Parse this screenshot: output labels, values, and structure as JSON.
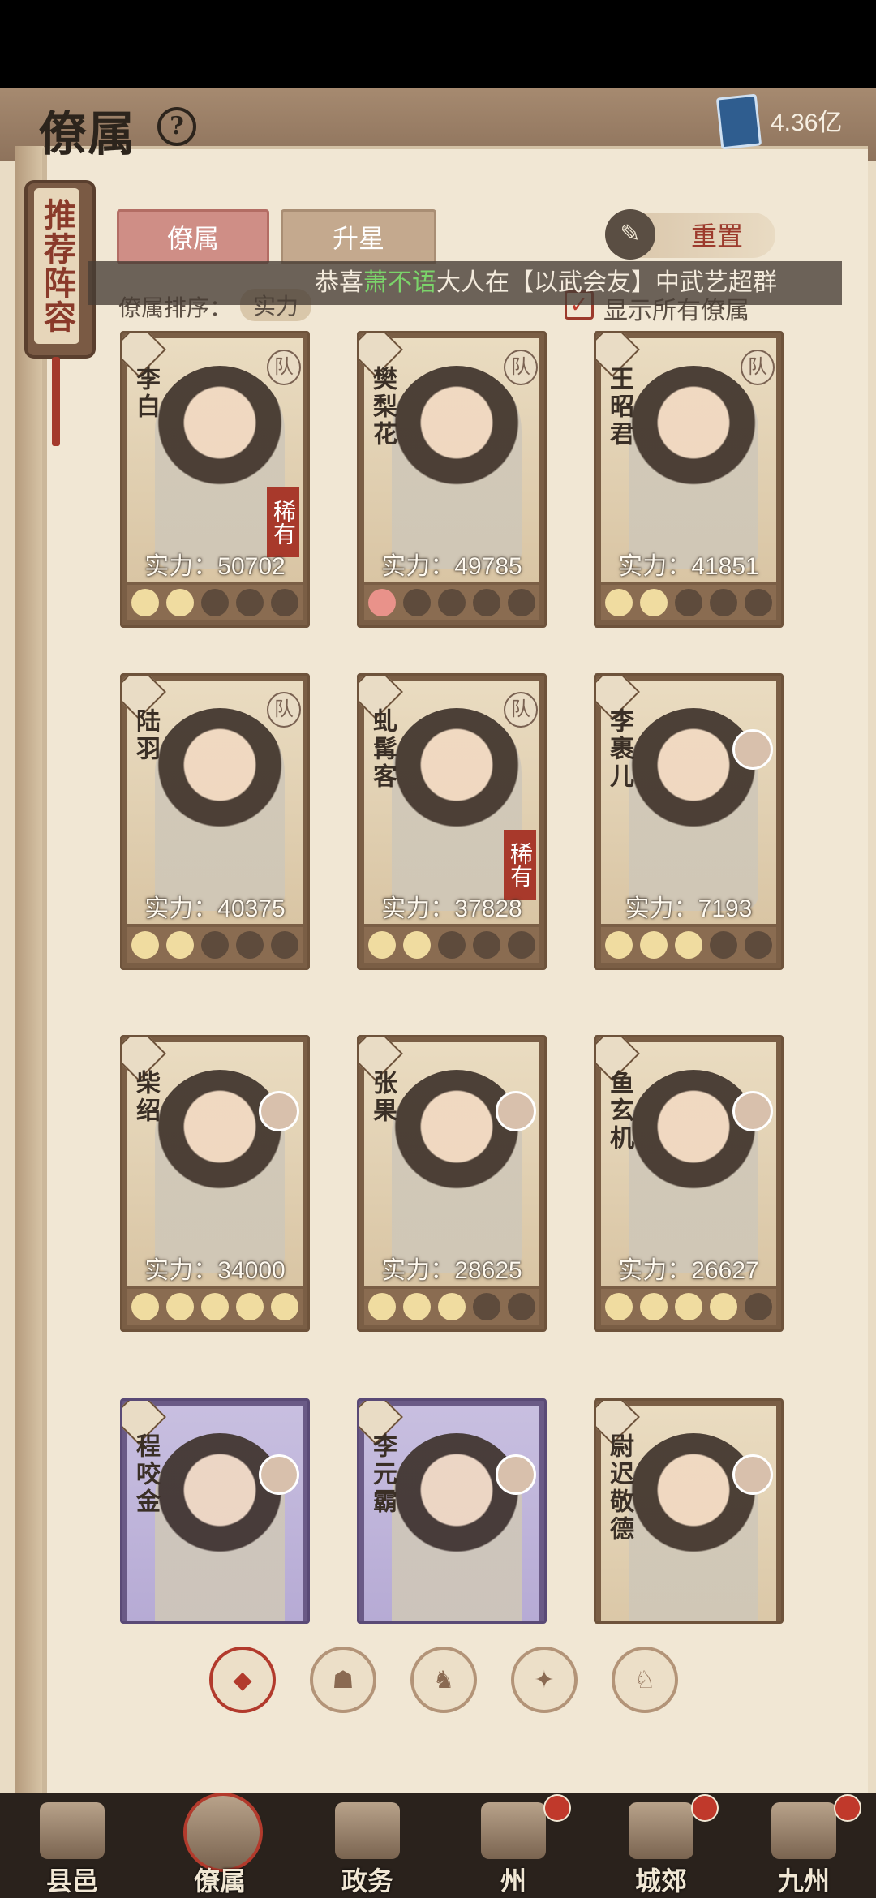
{
  "header": {
    "title": "僚属",
    "help": "?",
    "currency": "4.36亿"
  },
  "recommend": {
    "label": "推荐阵容"
  },
  "tabs": [
    {
      "label": "僚属"
    },
    {
      "label": "升星"
    }
  ],
  "reset": {
    "label": "重置"
  },
  "marquee": {
    "pre": "恭喜",
    "name": "萧不语",
    "post": "大人在【以武会友】中武艺超群"
  },
  "sort": {
    "label": "僚属排序：",
    "value": "实力"
  },
  "show_all": {
    "label": "显示所有僚属",
    "checked": true
  },
  "cards": [
    {
      "name": "李白",
      "power": "实力：50702",
      "rare": "稀有",
      "badge": "队",
      "stars": 2,
      "red": false
    },
    {
      "name": "樊梨花",
      "power": "实力：49785",
      "badge": "队",
      "stars": 1,
      "red": true
    },
    {
      "name": "王昭君",
      "power": "实力：41851",
      "badge": "队",
      "stars": 2,
      "red": false
    },
    {
      "name": "陆羽",
      "power": "实力：40375",
      "badge": "队",
      "stars": 2,
      "red": false
    },
    {
      "name": "虬髯客",
      "power": "实力：37828",
      "rare": "稀有",
      "badge": "队",
      "stars": 2,
      "red": false
    },
    {
      "name": "李裹儿",
      "power": "实力：7193",
      "stars": 3,
      "red": false
    },
    {
      "name": "柴绍",
      "power": "实力：34000",
      "stars": 5,
      "red": false
    },
    {
      "name": "张果",
      "power": "实力：28625",
      "stars": 3,
      "red": false
    },
    {
      "name": "鱼玄机",
      "power": "实力：26627",
      "stars": 4,
      "red": false
    },
    {
      "name": "程咬金",
      "power": "",
      "stars": 0,
      "purple": true
    },
    {
      "name": "李元霸",
      "power": "",
      "stars": 0,
      "purple": true
    },
    {
      "name": "尉迟敬德",
      "power": "",
      "stars": 0
    }
  ],
  "filters": [
    "◆",
    "☗",
    "♞",
    "✦",
    "♘"
  ],
  "nav": [
    {
      "label": "县邑"
    },
    {
      "label": "僚属"
    },
    {
      "label": "政务"
    },
    {
      "label": "州"
    },
    {
      "label": "城郊"
    },
    {
      "label": "九州"
    }
  ],
  "colors": {
    "accent": "#b23a2c",
    "tab_active": "#cf8e86",
    "paper": "#f1e7d4"
  }
}
